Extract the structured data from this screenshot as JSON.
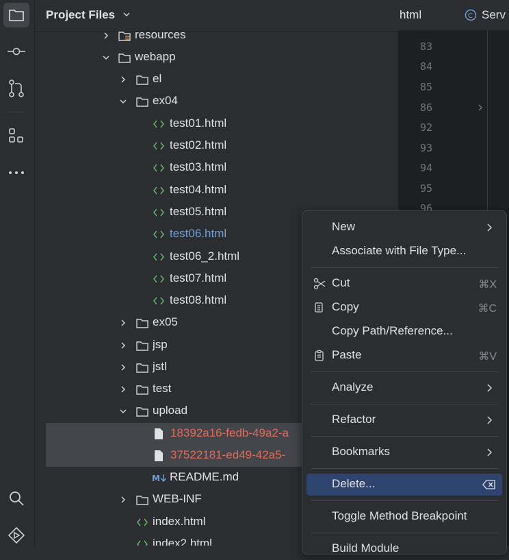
{
  "panel": {
    "title": "Project Files"
  },
  "tree": {
    "resources": "resources",
    "webapp": "webapp",
    "el": "el",
    "ex04": "ex04",
    "files_ex04": [
      "test01.html",
      "test02.html",
      "test03.html",
      "test04.html",
      "test05.html",
      "test06.html",
      "test06_2.html",
      "test07.html",
      "test08.html"
    ],
    "ex05": "ex05",
    "jsp": "jsp",
    "jstl": "jstl",
    "test": "test",
    "upload": "upload",
    "upload_files": [
      "18392a16-fedb-49a2-a",
      "37522181-ed49-42a5-"
    ],
    "readme": "README.md",
    "webinf": "WEB-INF",
    "index": "index.html",
    "index2": "index2.html"
  },
  "editor": {
    "tab1": "html",
    "tab2": "Serv",
    "line_numbers": [
      "83",
      "84",
      "85",
      "86",
      "92",
      "93",
      "94",
      "95",
      "96"
    ]
  },
  "menu": {
    "items": [
      {
        "label": "New",
        "shortcut": ""
      },
      {
        "label": "Associate with File Type...",
        "shortcut": ""
      },
      {
        "label": "Cut",
        "shortcut": "⌘X"
      },
      {
        "label": "Copy",
        "shortcut": "⌘C"
      },
      {
        "label": "Copy Path/Reference...",
        "shortcut": ""
      },
      {
        "label": "Paste",
        "shortcut": "⌘V"
      },
      {
        "label": "Analyze",
        "shortcut": ""
      },
      {
        "label": "Refactor",
        "shortcut": ""
      },
      {
        "label": "Bookmarks",
        "shortcut": ""
      },
      {
        "label": "Delete...",
        "shortcut": ""
      },
      {
        "label": "Toggle Method Breakpoint",
        "shortcut": ""
      },
      {
        "label": "Build Module",
        "shortcut": ""
      }
    ]
  },
  "colors": {
    "accent_selection": "#2e436e",
    "html_icon": "#5fb865",
    "modified_blue": "#6f9fd8",
    "untracked_red": "#e06c5a"
  }
}
